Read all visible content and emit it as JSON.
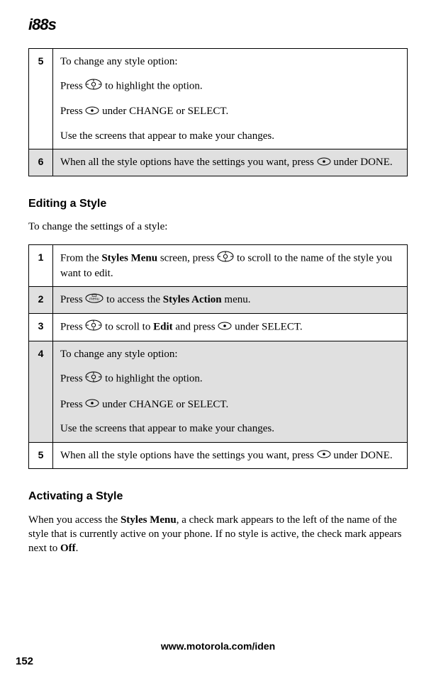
{
  "header_logo": "i88s",
  "table1_step5_num": "5",
  "table1_step5_line1": "To change any style option:",
  "table1_step5_line2a": "Press ",
  "table1_step5_line2b": " to highlight the option.",
  "table1_step5_line3a": "Press ",
  "table1_step5_line3b": " under CHANGE or SELECT.",
  "table1_step5_line4": "Use the screens that appear to make your changes.",
  "table1_step6_num": "6",
  "table1_step6_a": "When all the style options have the settings you want, press ",
  "table1_step6_b": " under DONE.",
  "editing_heading": "Editing a Style",
  "editing_intro": "To change the settings of a style:",
  "table2_step1_num": "1",
  "table2_step1_a": "From the ",
  "table2_step1_bold1": "Styles Menu",
  "table2_step1_b": " screen, press ",
  "table2_step1_c": " to scroll to the name of the style you want to edit.",
  "table2_step2_num": "2",
  "table2_step2_a": "Press ",
  "table2_step2_b": " to access the ",
  "table2_step2_bold1": "Styles Action",
  "table2_step2_c": " menu.",
  "table2_step3_num": "3",
  "table2_step3_a": "Press ",
  "table2_step3_b": " to scroll to ",
  "table2_step3_bold1": "Edit",
  "table2_step3_c": " and press ",
  "table2_step3_d": " under SELECT.",
  "table2_step4_num": "4",
  "table2_step4_line1": "To change any style option:",
  "table2_step4_line2a": "Press ",
  "table2_step4_line2b": " to highlight the option.",
  "table2_step4_line3a": "Press ",
  "table2_step4_line3b": " under CHANGE or SELECT.",
  "table2_step4_line4": "Use the screens that appear to make your changes.",
  "table2_step5_num": "5",
  "table2_step5_a": "When all the style options have the settings you want, press ",
  "table2_step5_b": " under DONE.",
  "activating_heading": "Activating a Style",
  "activating_a": "When you access the ",
  "activating_bold1": "Styles Menu",
  "activating_b": ", a check mark appears to the left of the name of the style that is currently active on your phone. If no style is active, the check mark appears next to ",
  "activating_bold2": "Off",
  "activating_c": ".",
  "footer_url": "www.motorola.com/iden",
  "page_number": "152"
}
